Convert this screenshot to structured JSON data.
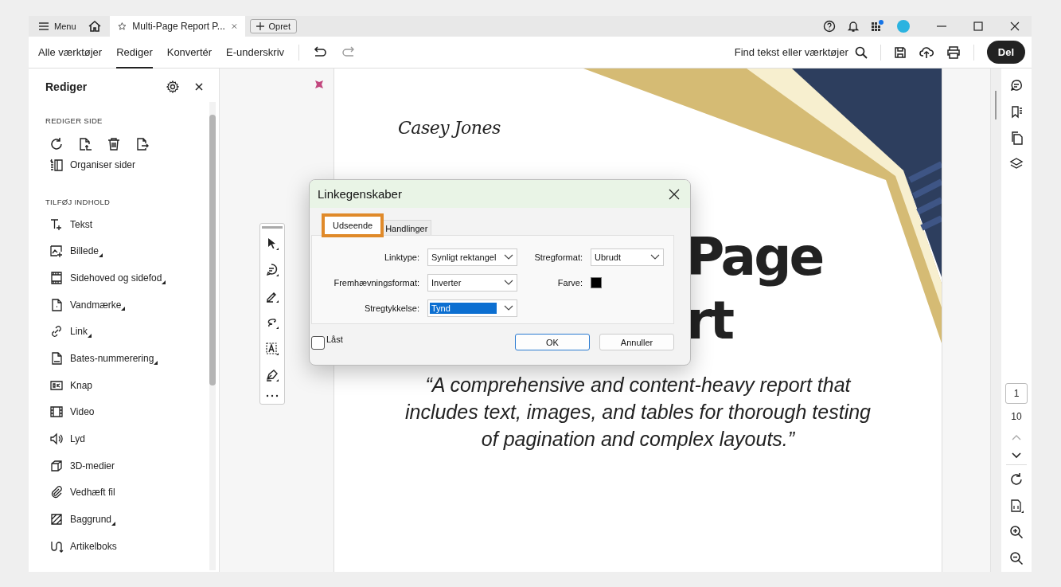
{
  "title_bar": {
    "menu": "Menu",
    "tab": {
      "title": "Multi-Page Report P...",
      "selected": true
    },
    "create_button": "Opret"
  },
  "toolbar": {
    "tabs": [
      {
        "label": "Alle værktøjer",
        "selected": false
      },
      {
        "label": "Rediger",
        "selected": true
      },
      {
        "label": "Konvertér",
        "selected": false
      },
      {
        "label": "E-underskriv",
        "selected": false
      }
    ],
    "search": "Find tekst eller værktøjer",
    "share_button": "Del"
  },
  "panel": {
    "title": "Rediger",
    "page_heading": "REDIGER SIDE",
    "organize": "Organiser sider",
    "content_heading": "TILFØJ INDHOLD",
    "items": [
      {
        "label": "Tekst",
        "submenu": false
      },
      {
        "label": "Billede",
        "submenu": true
      },
      {
        "label": "Sidehoved og sidefod",
        "submenu": true
      },
      {
        "label": "Vandmærke",
        "submenu": true
      },
      {
        "label": "Link",
        "submenu": true
      },
      {
        "label": "Bates-nummerering",
        "submenu": true
      },
      {
        "label": "Knap",
        "submenu": false
      },
      {
        "label": "Video",
        "submenu": false
      },
      {
        "label": "Lyd",
        "submenu": false
      },
      {
        "label": "3D-medier",
        "submenu": false
      },
      {
        "label": "Vedhæft fil",
        "submenu": false
      },
      {
        "label": "Baggrund",
        "submenu": true
      },
      {
        "label": "Artikelboks",
        "submenu": false
      }
    ]
  },
  "document": {
    "signature": "Casey Jones",
    "title_lines": [
      "Page",
      "rt"
    ],
    "quote": "“A comprehensive and content-heavy report that includes text, images, and tables for thorough testing of pagination and complex layouts.”"
  },
  "page_nav": {
    "current": "1",
    "total": "10"
  },
  "dialog": {
    "title": "Linkegenskaber",
    "tabs": [
      {
        "label": "Udseende",
        "selected": true,
        "outlined": true
      },
      {
        "label": "Handlinger",
        "selected": false,
        "outlined": false
      }
    ],
    "fields": [
      {
        "kind": "select",
        "label": "Linktype:",
        "value": "Synligt rektangel",
        "highlighted": false
      },
      {
        "kind": "select",
        "label": "Stregformat:",
        "value": "Ubrudt",
        "highlighted": false
      },
      {
        "kind": "select",
        "label": "Fremhævningsformat:",
        "value": "Inverter",
        "highlighted": false
      },
      {
        "kind": "color",
        "label": "Farve:",
        "color": "#000000"
      },
      {
        "kind": "select",
        "label": "Stregtykkelse:",
        "value": "Tynd",
        "highlighted": true
      }
    ],
    "locked": {
      "label": "Låst",
      "checked": false
    },
    "buttons": [
      {
        "label": "OK",
        "kind": "primary"
      },
      {
        "label": "Annuller",
        "kind": "secondary"
      }
    ]
  }
}
